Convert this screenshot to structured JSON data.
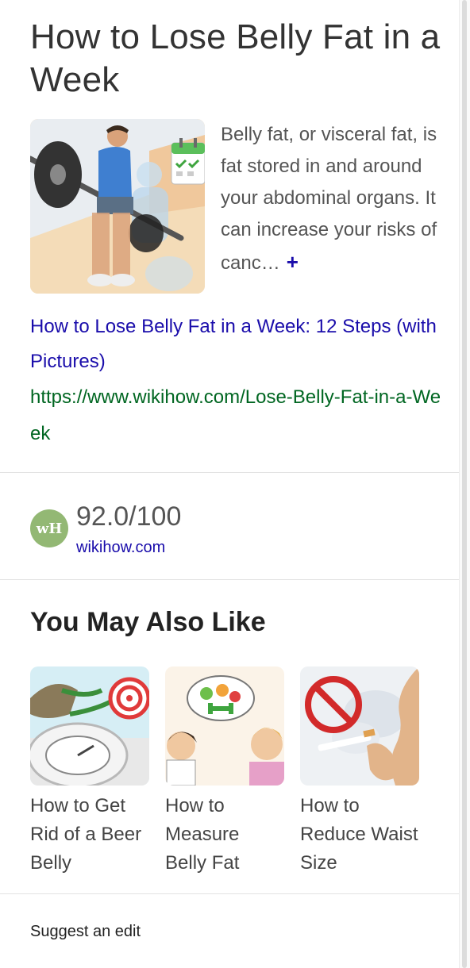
{
  "article": {
    "title": "How to Lose Belly Fat in a Week",
    "snippet": "Belly fat, or visceral fat, is fat stored in and around your abdominal organs. It can increase your risks of canc…",
    "expand_icon": "plus-icon",
    "expand_symbol": "+"
  },
  "result": {
    "link_text": "How to Lose Belly Fat in a Week: 12 Steps (with Pictures)",
    "url": "https://www.wikihow.com/Lose-Belly-Fat-in-a-Week"
  },
  "rating": {
    "logo_text": "wH",
    "score": "92.0/100",
    "site": "wikihow.com",
    "logo_color": "#93b874"
  },
  "also_like": {
    "heading": "You May Also Like",
    "items": [
      {
        "label": "How to Get Rid of a Beer Belly"
      },
      {
        "label": "How to Measure Belly Fat"
      },
      {
        "label": "How to Reduce Waist Size"
      }
    ]
  },
  "footer": {
    "suggest_edit": "Suggest an edit"
  },
  "colors": {
    "link": "#1a0dab",
    "url": "#006621",
    "text": "#555555"
  }
}
